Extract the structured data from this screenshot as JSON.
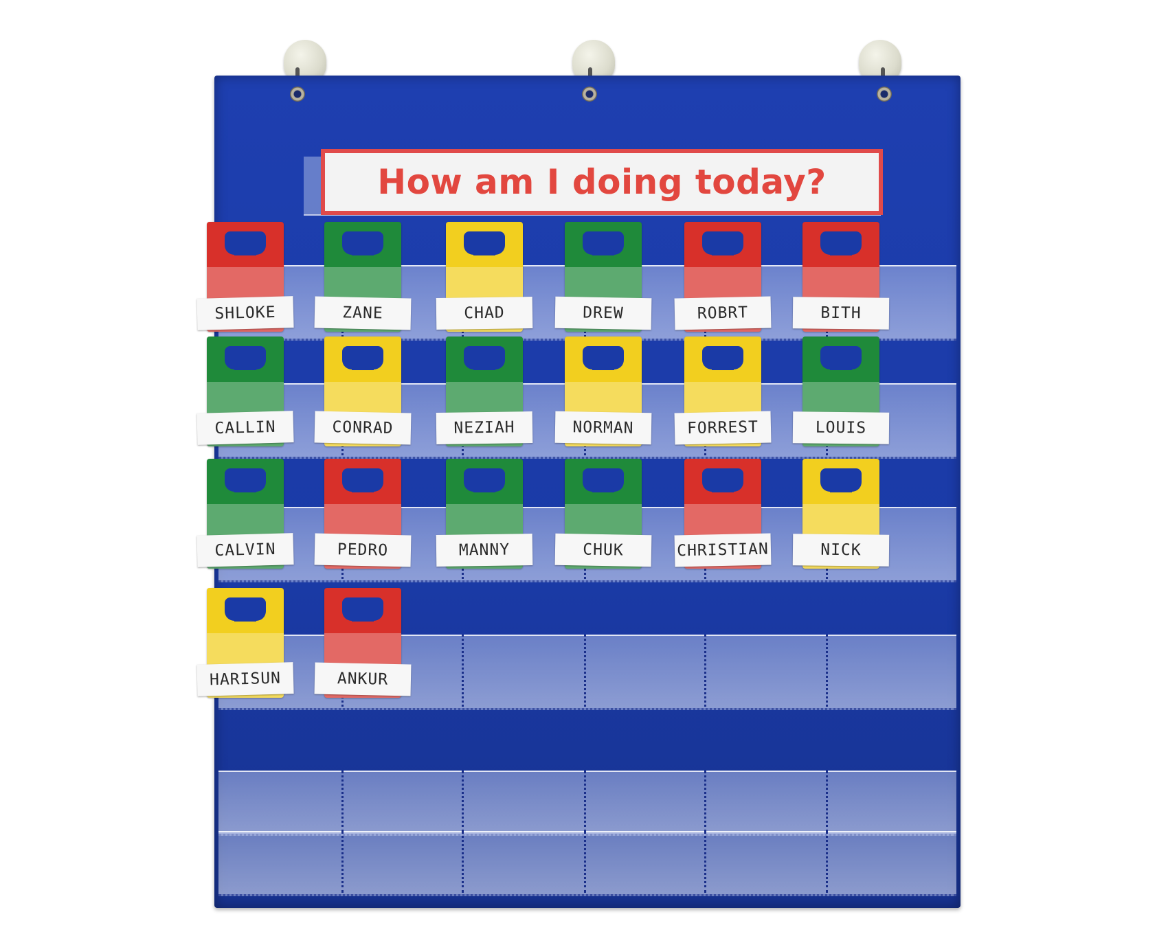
{
  "title": "How am I doing today?",
  "colors": {
    "chart_blue": "#1a3aa6",
    "title_red": "#e2473f",
    "card_red": "#d8302a",
    "card_green": "#1f8a3a",
    "card_yellow": "#f2cf1f"
  },
  "rows": [
    [
      {
        "name": "SHLOKE",
        "color": "red"
      },
      {
        "name": "ZANE",
        "color": "green"
      },
      {
        "name": "CHAD",
        "color": "yellow"
      },
      {
        "name": "DREW",
        "color": "green"
      },
      {
        "name": "ROBRT",
        "color": "red"
      },
      {
        "name": "BITH",
        "color": "red"
      }
    ],
    [
      {
        "name": "CALLIN",
        "color": "green"
      },
      {
        "name": "CONRAD",
        "color": "yellow"
      },
      {
        "name": "NEZIAH",
        "color": "green"
      },
      {
        "name": "NORMAN",
        "color": "yellow"
      },
      {
        "name": "FORREST",
        "color": "yellow"
      },
      {
        "name": "LOUIS",
        "color": "green"
      }
    ],
    [
      {
        "name": "CALVIN",
        "color": "green"
      },
      {
        "name": "PEDRO",
        "color": "red"
      },
      {
        "name": "MANNY",
        "color": "green"
      },
      {
        "name": "CHUK",
        "color": "green"
      },
      {
        "name": "CHRISTIAN",
        "color": "red"
      },
      {
        "name": "NICK",
        "color": "yellow"
      }
    ],
    [
      {
        "name": "HARISUN",
        "color": "yellow"
      },
      {
        "name": "ANKUR",
        "color": "red"
      }
    ]
  ]
}
